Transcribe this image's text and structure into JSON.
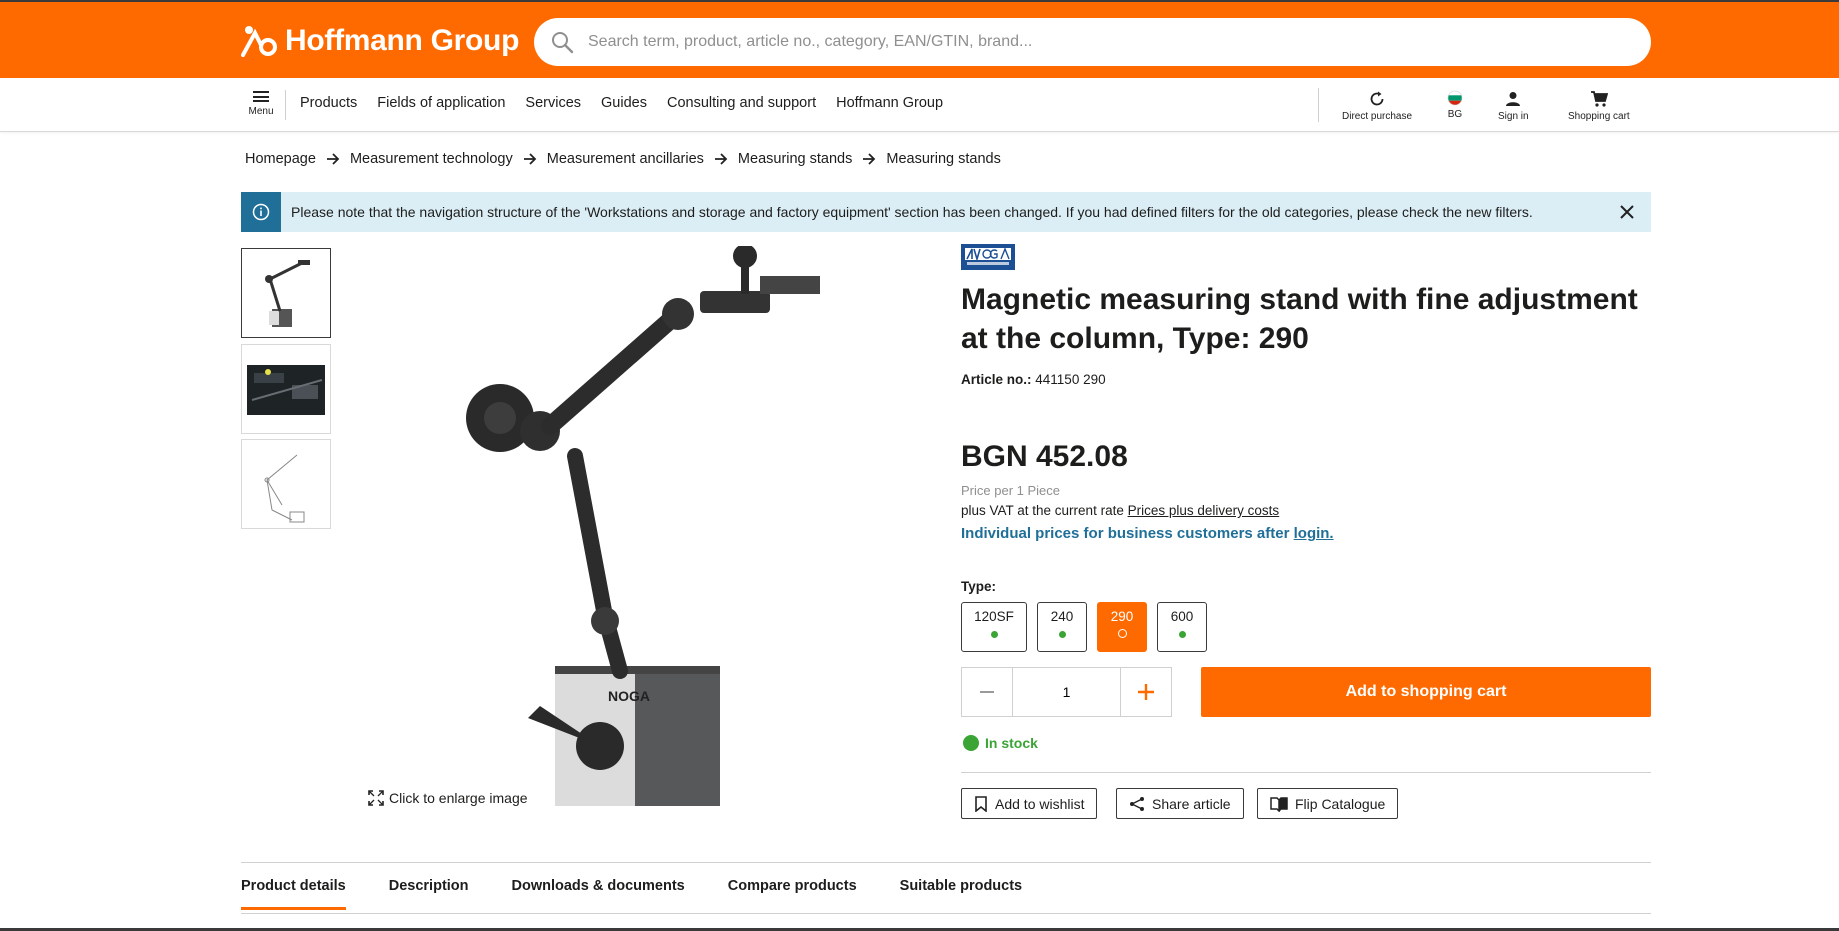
{
  "header": {
    "logo_text": "Hoffmann Group",
    "search_placeholder": "Search term, product, article no., category, EAN/GTIN, brand..."
  },
  "nav": {
    "menu_label": "Menu",
    "links": [
      "Products",
      "Fields of application",
      "Services",
      "Guides",
      "Consulting and support",
      "Hoffmann Group"
    ],
    "tools": {
      "direct_purchase": "Direct purchase",
      "country": "BG",
      "sign_in": "Sign in",
      "cart": "Shopping cart"
    }
  },
  "breadcrumb": [
    "Homepage",
    "Measurement technology",
    "Measurement ancillaries",
    "Measuring stands",
    "Measuring stands"
  ],
  "banner": {
    "text": "Please note that the navigation structure of the 'Workstations and storage and factory equipment' section has been changed. If you had defined filters for the old categories, please check the new filters."
  },
  "gallery": {
    "enlarge_label": "Click to enlarge image"
  },
  "product": {
    "brand": "NOGA",
    "title": "Magnetic measuring stand with fine adjustment at the column, Type: 290",
    "article_label": "Article no.:",
    "article_no": "441150 290",
    "price": "BGN 452.08",
    "price_per": "Price per 1 Piece",
    "vat_text": "plus VAT at the current rate",
    "vat_link": "Prices plus delivery costs",
    "business_text": "Individual prices for business customers after",
    "business_link": "login.",
    "type_label": "Type:",
    "types": [
      "120SF",
      "240",
      "290",
      "600"
    ],
    "selected_type": "290",
    "quantity": "1",
    "add_to_cart": "Add to shopping cart",
    "stock": "In stock",
    "actions": {
      "wishlist": "Add to wishlist",
      "share": "Share article",
      "catalogue": "Flip Catalogue"
    }
  },
  "tabs": [
    "Product details",
    "Description",
    "Downloads & documents",
    "Compare products",
    "Suitable products"
  ],
  "colors": {
    "brand_orange": "#ff6a00",
    "info_blue": "#1f6f98",
    "stock_green": "#3aa535"
  }
}
